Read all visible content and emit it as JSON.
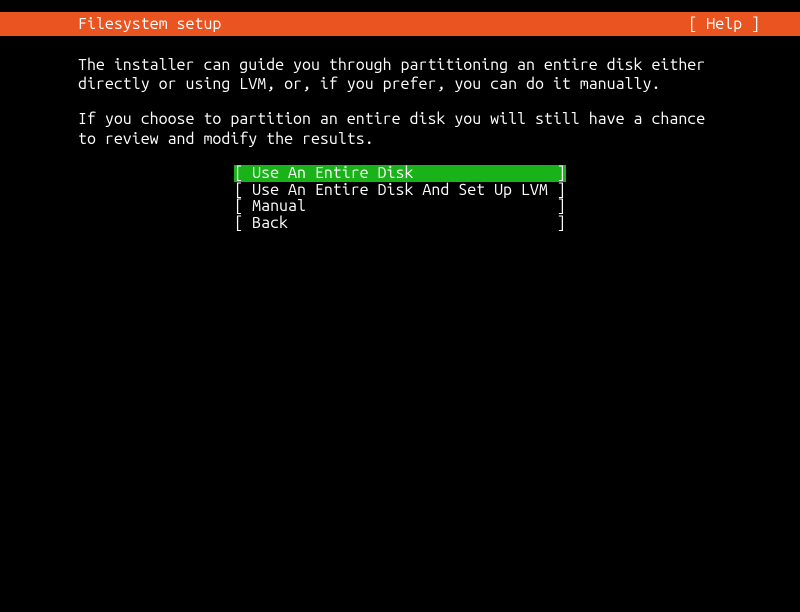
{
  "header": {
    "title": "Filesystem setup",
    "help": "[ Help ]"
  },
  "description": {
    "para1": "The installer can guide you through partitioning an entire disk either directly or using LVM, or, if you prefer, you can do it manually.",
    "para2": "If you choose to partition an entire disk you will still have a chance to review and modify the results."
  },
  "menu": {
    "items": [
      {
        "label": "Use An Entire Disk",
        "selected": true
      },
      {
        "label": "Use An Entire Disk And Set Up LVM",
        "selected": false
      },
      {
        "label": "Manual",
        "selected": false
      },
      {
        "label": "Back",
        "selected": false
      }
    ],
    "bracket_left": "[ ",
    "bracket_right": " ]",
    "pad_width": 33
  }
}
